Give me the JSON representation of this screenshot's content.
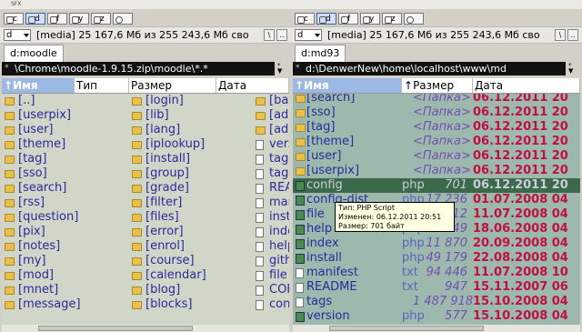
{
  "titlebar": {
    "text": "SFX"
  },
  "left": {
    "drives": [
      "c",
      "d",
      "f",
      "y",
      "z"
    ],
    "active_drive": "d",
    "drive_combo": "d",
    "free_space": "[media]  25 167,6 Мб из 255 243,6 Мб сво",
    "btn_backslash": "\\",
    "btn_dotdot": "..",
    "tab_label": "d:moodle",
    "path": "\\Chrome\\moodle-1.9.15.zip\\moodle\\*.*",
    "headers": {
      "name": "Имя",
      "type": "Тип",
      "size": "Размер",
      "date": "Дата"
    },
    "col1": [
      "[..]",
      "[userpix]",
      "[user]",
      "[theme]",
      "[tag]",
      "[sso]",
      "[search]",
      "[rss]",
      "[question]",
      "[pix]",
      "[notes]",
      "[my]",
      "[mod]",
      "[mnet]",
      "[message]"
    ],
    "col2": [
      "[login]",
      "[lib]",
      "[lang]",
      "[iplookup]",
      "[install]",
      "[group]",
      "[grade]",
      "[filter]",
      "[files]",
      "[error]",
      "[enrol]",
      "[course]",
      "[calendar]",
      "[blog]",
      "[blocks]"
    ],
    "col3": [
      "[ba",
      "[ad",
      "[ad",
      "vers",
      "tags",
      "tags",
      "REA",
      "mar",
      "inst",
      "inde",
      "help",
      "gith",
      "file",
      "COF",
      "con"
    ]
  },
  "right": {
    "drives": [
      "c",
      "d",
      "f",
      "y",
      "z"
    ],
    "active_drive": "d",
    "drive_combo": "d",
    "free_space": "[media]  25 167,6 Мб из 255 243,6 Мб сво",
    "btn_backslash": "\\",
    "btn_dotdot": "..",
    "tab_label": "d:md93",
    "path": "d:\\DenwerNew\\home\\localhost\\www\\md",
    "headers": {
      "name": "Имя",
      "size": "Размер",
      "date": "Дата"
    },
    "rows": [
      {
        "name": "[search]",
        "type": "",
        "size": "<Папка>",
        "date": "06.12.2011 20",
        "kind": "dir"
      },
      {
        "name": "[sso]",
        "type": "",
        "size": "<Папка>",
        "date": "06.12.2011 20",
        "kind": "dir"
      },
      {
        "name": "[tag]",
        "type": "",
        "size": "<Папка>",
        "date": "06.12.2011 20",
        "kind": "dir"
      },
      {
        "name": "[theme]",
        "type": "",
        "size": "<Папка>",
        "date": "06.12.2011 20",
        "kind": "dir"
      },
      {
        "name": "[user]",
        "type": "",
        "size": "<Папка>",
        "date": "06.12.2011 20",
        "kind": "dir"
      },
      {
        "name": "[userpix]",
        "type": "",
        "size": "<Папка>",
        "date": "06.12.2011 20",
        "kind": "dir"
      },
      {
        "name": "config",
        "type": "php",
        "size": "701",
        "date": "06.12.2011 20",
        "kind": "php",
        "selected": true
      },
      {
        "name": "config-dist",
        "type": "php",
        "size": "17 236",
        "date": "01.07.2008 04",
        "kind": "php"
      },
      {
        "name": "file",
        "type": "php",
        "size": "2 912",
        "date": "11.07.2008 04",
        "kind": "php"
      },
      {
        "name": "help",
        "type": "php",
        "size": "5 649",
        "date": "18.06.2008 04",
        "kind": "php"
      },
      {
        "name": "index",
        "type": "php",
        "size": "11 870",
        "date": "20.09.2008 04",
        "kind": "php"
      },
      {
        "name": "install",
        "type": "php",
        "size": "49 179",
        "date": "22.08.2008 04",
        "kind": "php"
      },
      {
        "name": "manifest",
        "type": "txt",
        "size": "94 446",
        "date": "11.07.2008 10",
        "kind": "file"
      },
      {
        "name": "README",
        "type": "txt",
        "size": "947",
        "date": "15.11.2007 06",
        "kind": "file"
      },
      {
        "name": "tags",
        "type": "",
        "size": "1 487 918",
        "date": "15.10.2008 04",
        "kind": "file"
      },
      {
        "name": "version",
        "type": "php",
        "size": "577",
        "date": "15.10.2008 04",
        "kind": "php"
      }
    ]
  },
  "tooltip": {
    "line1": "Тип: PHP Script",
    "line2": "Изменен: 06.12.2011 20:51",
    "line3": "Размер: 701 байт"
  }
}
